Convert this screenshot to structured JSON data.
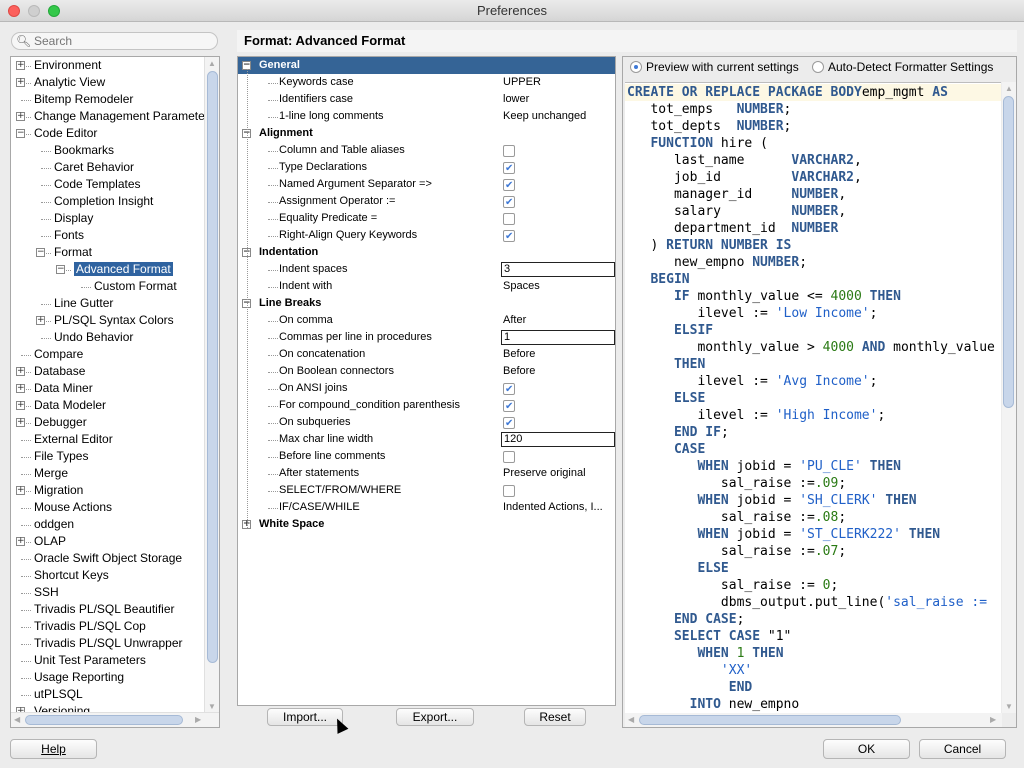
{
  "window": {
    "title": "Preferences"
  },
  "search": {
    "placeholder": "Search",
    "icon": "magnifier-icon"
  },
  "nav": {
    "items": [
      {
        "label": "Environment",
        "level": 0,
        "expander": "plus"
      },
      {
        "label": "Analytic View",
        "level": 0,
        "expander": "plus"
      },
      {
        "label": "Bitemp Remodeler",
        "level": 0,
        "expander": "none"
      },
      {
        "label": "Change Management Parameter:",
        "level": 0,
        "expander": "plus"
      },
      {
        "label": "Code Editor",
        "level": 0,
        "expander": "minus"
      },
      {
        "label": "Bookmarks",
        "level": 1,
        "expander": "none"
      },
      {
        "label": "Caret Behavior",
        "level": 1,
        "expander": "none"
      },
      {
        "label": "Code Templates",
        "level": 1,
        "expander": "none"
      },
      {
        "label": "Completion Insight",
        "level": 1,
        "expander": "none"
      },
      {
        "label": "Display",
        "level": 1,
        "expander": "none"
      },
      {
        "label": "Fonts",
        "level": 1,
        "expander": "none"
      },
      {
        "label": "Format",
        "level": 1,
        "expander": "minus"
      },
      {
        "label": "Advanced Format",
        "level": 2,
        "expander": "minus",
        "selected": true
      },
      {
        "label": "Custom Format",
        "level": 3,
        "expander": "none"
      },
      {
        "label": "Line Gutter",
        "level": 1,
        "expander": "none"
      },
      {
        "label": "PL/SQL Syntax Colors",
        "level": 1,
        "expander": "plus"
      },
      {
        "label": "Undo Behavior",
        "level": 1,
        "expander": "none"
      },
      {
        "label": "Compare",
        "level": 0,
        "expander": "none"
      },
      {
        "label": "Database",
        "level": 0,
        "expander": "plus"
      },
      {
        "label": "Data Miner",
        "level": 0,
        "expander": "plus"
      },
      {
        "label": "Data Modeler",
        "level": 0,
        "expander": "plus"
      },
      {
        "label": "Debugger",
        "level": 0,
        "expander": "plus"
      },
      {
        "label": "External Editor",
        "level": 0,
        "expander": "none"
      },
      {
        "label": "File Types",
        "level": 0,
        "expander": "none"
      },
      {
        "label": "Merge",
        "level": 0,
        "expander": "none"
      },
      {
        "label": "Migration",
        "level": 0,
        "expander": "plus"
      },
      {
        "label": "Mouse Actions",
        "level": 0,
        "expander": "none"
      },
      {
        "label": "oddgen",
        "level": 0,
        "expander": "none"
      },
      {
        "label": "OLAP",
        "level": 0,
        "expander": "plus"
      },
      {
        "label": "Oracle Swift Object Storage",
        "level": 0,
        "expander": "none"
      },
      {
        "label": "Shortcut Keys",
        "level": 0,
        "expander": "none"
      },
      {
        "label": "SSH",
        "level": 0,
        "expander": "none"
      },
      {
        "label": "Trivadis PL/SQL Beautifier",
        "level": 0,
        "expander": "none"
      },
      {
        "label": "Trivadis PL/SQL Cop",
        "level": 0,
        "expander": "none"
      },
      {
        "label": "Trivadis PL/SQL Unwrapper",
        "level": 0,
        "expander": "none"
      },
      {
        "label": "Unit Test Parameters",
        "level": 0,
        "expander": "none"
      },
      {
        "label": "Usage Reporting",
        "level": 0,
        "expander": "none"
      },
      {
        "label": "utPLSQL",
        "level": 0,
        "expander": "none"
      },
      {
        "label": "Versioning",
        "level": 0,
        "expander": "plus"
      }
    ]
  },
  "page": {
    "title": "Format: Advanced Format"
  },
  "options": [
    {
      "type": "category",
      "label": "General",
      "expander": "minus",
      "highlighted": true
    },
    {
      "type": "text",
      "label": "Keywords case",
      "value": "UPPER"
    },
    {
      "type": "text",
      "label": "Identifiers case",
      "value": "lower"
    },
    {
      "type": "text",
      "label": "1-line long comments",
      "value": "Keep unchanged"
    },
    {
      "type": "category",
      "label": "Alignment",
      "expander": "minus"
    },
    {
      "type": "checkbox",
      "label": "Column and Table aliases",
      "checked": false
    },
    {
      "type": "checkbox",
      "label": "Type Declarations",
      "checked": true
    },
    {
      "type": "checkbox",
      "label": "Named Argument Separator =>",
      "checked": true
    },
    {
      "type": "checkbox",
      "label": "Assignment Operator :=",
      "checked": true
    },
    {
      "type": "checkbox",
      "label": "Equality Predicate =",
      "checked": false
    },
    {
      "type": "checkbox",
      "label": "Right-Align Query Keywords",
      "checked": true
    },
    {
      "type": "category",
      "label": "Indentation",
      "expander": "minus"
    },
    {
      "type": "input",
      "label": "Indent spaces",
      "value": "3"
    },
    {
      "type": "text",
      "label": "Indent with",
      "value": "Spaces"
    },
    {
      "type": "category",
      "label": "Line Breaks",
      "expander": "minus"
    },
    {
      "type": "text",
      "label": "On comma",
      "value": "After"
    },
    {
      "type": "input",
      "label": "Commas per line in procedures",
      "value": "1"
    },
    {
      "type": "text",
      "label": "On concatenation",
      "value": "Before"
    },
    {
      "type": "text",
      "label": "On Boolean connectors",
      "value": "Before"
    },
    {
      "type": "checkbox",
      "label": "On ANSI joins",
      "checked": true
    },
    {
      "type": "checkbox",
      "label": "For compound_condition parenthesis",
      "checked": true
    },
    {
      "type": "checkbox",
      "label": "On subqueries",
      "checked": true
    },
    {
      "type": "input",
      "label": "Max char line width",
      "value": "120"
    },
    {
      "type": "checkbox",
      "label": "Before line comments",
      "checked": false
    },
    {
      "type": "text",
      "label": "After statements",
      "value": "Preserve original"
    },
    {
      "type": "checkbox",
      "label": "SELECT/FROM/WHERE",
      "checked": false
    },
    {
      "type": "text",
      "label": "IF/CASE/WHILE",
      "value": "Indented Actions, I..."
    },
    {
      "type": "category",
      "label": "White Space",
      "expander": "plus"
    }
  ],
  "option_buttons": {
    "import": "Import...",
    "export": "Export...",
    "reset": "Reset"
  },
  "preview": {
    "radio_preview": "Preview with current settings",
    "radio_autodetect": "Auto-Detect Formatter Settings",
    "selected_radio": "preview",
    "code_lines": [
      [
        [
          "kw",
          "CREATE OR REPLACE PACKAGE BODY"
        ],
        [
          "",
          "emp_mgmt "
        ],
        [
          "kw",
          "AS"
        ]
      ],
      [
        [
          "",
          "   tot_emps   "
        ],
        [
          "kw",
          "NUMBER"
        ],
        [
          "",
          ";"
        ]
      ],
      [
        [
          "",
          "   tot_depts  "
        ],
        [
          "kw",
          "NUMBER"
        ],
        [
          "",
          ";"
        ]
      ],
      [
        [
          "",
          "   "
        ],
        [
          "kw",
          "FUNCTION"
        ],
        [
          "",
          " hire ("
        ]
      ],
      [
        [
          "",
          "      last_name      "
        ],
        [
          "kw",
          "VARCHAR2"
        ],
        [
          "",
          ","
        ]
      ],
      [
        [
          "",
          "      job_id         "
        ],
        [
          "kw",
          "VARCHAR2"
        ],
        [
          "",
          ","
        ]
      ],
      [
        [
          "",
          "      manager_id     "
        ],
        [
          "kw",
          "NUMBER"
        ],
        [
          "",
          ","
        ]
      ],
      [
        [
          "",
          "      salary         "
        ],
        [
          "kw",
          "NUMBER"
        ],
        [
          "",
          ","
        ]
      ],
      [
        [
          "",
          "      department_id  "
        ],
        [
          "kw",
          "NUMBER"
        ]
      ],
      [
        [
          "",
          "   ) "
        ],
        [
          "kw",
          "RETURN NUMBER IS"
        ]
      ],
      [
        [
          "",
          "      new_empno "
        ],
        [
          "kw",
          "NUMBER"
        ],
        [
          "",
          ";"
        ]
      ],
      [
        [
          "",
          "   "
        ],
        [
          "kw",
          "BEGIN"
        ]
      ],
      [
        [
          "",
          "      "
        ],
        [
          "kw",
          "IF"
        ],
        [
          "",
          " monthly_value <= "
        ],
        [
          "num",
          "4000"
        ],
        [
          "",
          " "
        ],
        [
          "kw",
          "THEN"
        ]
      ],
      [
        [
          "",
          "         ilevel := "
        ],
        [
          "str",
          "'Low Income'"
        ],
        [
          "",
          ";"
        ]
      ],
      [
        [
          "",
          "      "
        ],
        [
          "kw",
          "ELSIF"
        ]
      ],
      [
        [
          "",
          "         monthly_value > "
        ],
        [
          "num",
          "4000"
        ],
        [
          "",
          " "
        ],
        [
          "kw",
          "AND"
        ],
        [
          "",
          " monthly_value"
        ]
      ],
      [
        [
          "",
          "      "
        ],
        [
          "kw",
          "THEN"
        ]
      ],
      [
        [
          "",
          "         ilevel := "
        ],
        [
          "str",
          "'Avg Income'"
        ],
        [
          "",
          ";"
        ]
      ],
      [
        [
          "",
          "      "
        ],
        [
          "kw",
          "ELSE"
        ]
      ],
      [
        [
          "",
          "         ilevel := "
        ],
        [
          "str",
          "'High Income'"
        ],
        [
          "",
          ";"
        ]
      ],
      [
        [
          "",
          "      "
        ],
        [
          "kw",
          "END IF"
        ],
        [
          "",
          ";"
        ]
      ],
      [
        [
          "",
          "      "
        ],
        [
          "kw",
          "CASE"
        ]
      ],
      [
        [
          "",
          "         "
        ],
        [
          "kw",
          "WHEN"
        ],
        [
          "",
          " jobid = "
        ],
        [
          "str",
          "'PU_CLE'"
        ],
        [
          "",
          " "
        ],
        [
          "kw",
          "THEN"
        ]
      ],
      [
        [
          "",
          "            sal_raise :="
        ],
        [
          "num",
          ".09"
        ],
        [
          "",
          ";"
        ]
      ],
      [
        [
          "",
          "         "
        ],
        [
          "kw",
          "WHEN"
        ],
        [
          "",
          " jobid = "
        ],
        [
          "str",
          "'SH_CLERK'"
        ],
        [
          "",
          " "
        ],
        [
          "kw",
          "THEN"
        ]
      ],
      [
        [
          "",
          "            sal_raise :="
        ],
        [
          "num",
          ".08"
        ],
        [
          "",
          ";"
        ]
      ],
      [
        [
          "",
          "         "
        ],
        [
          "kw",
          "WHEN"
        ],
        [
          "",
          " jobid = "
        ],
        [
          "str",
          "'ST_CLERK222'"
        ],
        [
          "",
          " "
        ],
        [
          "kw",
          "THEN"
        ]
      ],
      [
        [
          "",
          "            sal_raise :="
        ],
        [
          "num",
          ".07"
        ],
        [
          "",
          ";"
        ]
      ],
      [
        [
          "",
          "         "
        ],
        [
          "kw",
          "ELSE"
        ]
      ],
      [
        [
          "",
          "            sal_raise := "
        ],
        [
          "num",
          "0"
        ],
        [
          "",
          ";"
        ]
      ],
      [
        [
          "",
          "            dbms_output.put_line("
        ],
        [
          "str",
          "'sal_raise :="
        ]
      ],
      [
        [
          "",
          "      "
        ],
        [
          "kw",
          "END CASE"
        ],
        [
          "",
          ";"
        ]
      ],
      [
        [
          "",
          "      "
        ],
        [
          "kw",
          "SELECT CASE"
        ],
        [
          "",
          " \"1\""
        ]
      ],
      [
        [
          "",
          "         "
        ],
        [
          "kw",
          "WHEN"
        ],
        [
          "",
          " "
        ],
        [
          "num",
          "1"
        ],
        [
          "",
          " "
        ],
        [
          "kw",
          "THEN"
        ]
      ],
      [
        [
          "",
          "            "
        ],
        [
          "str",
          "'XX'"
        ]
      ],
      [
        [
          "",
          "             "
        ],
        [
          "kw",
          "END"
        ]
      ],
      [
        [
          "",
          "        "
        ],
        [
          "kw",
          "INTO"
        ],
        [
          "",
          " new_empno"
        ]
      ]
    ]
  },
  "footer": {
    "help": "Help",
    "ok": "OK",
    "cancel": "Cancel"
  }
}
